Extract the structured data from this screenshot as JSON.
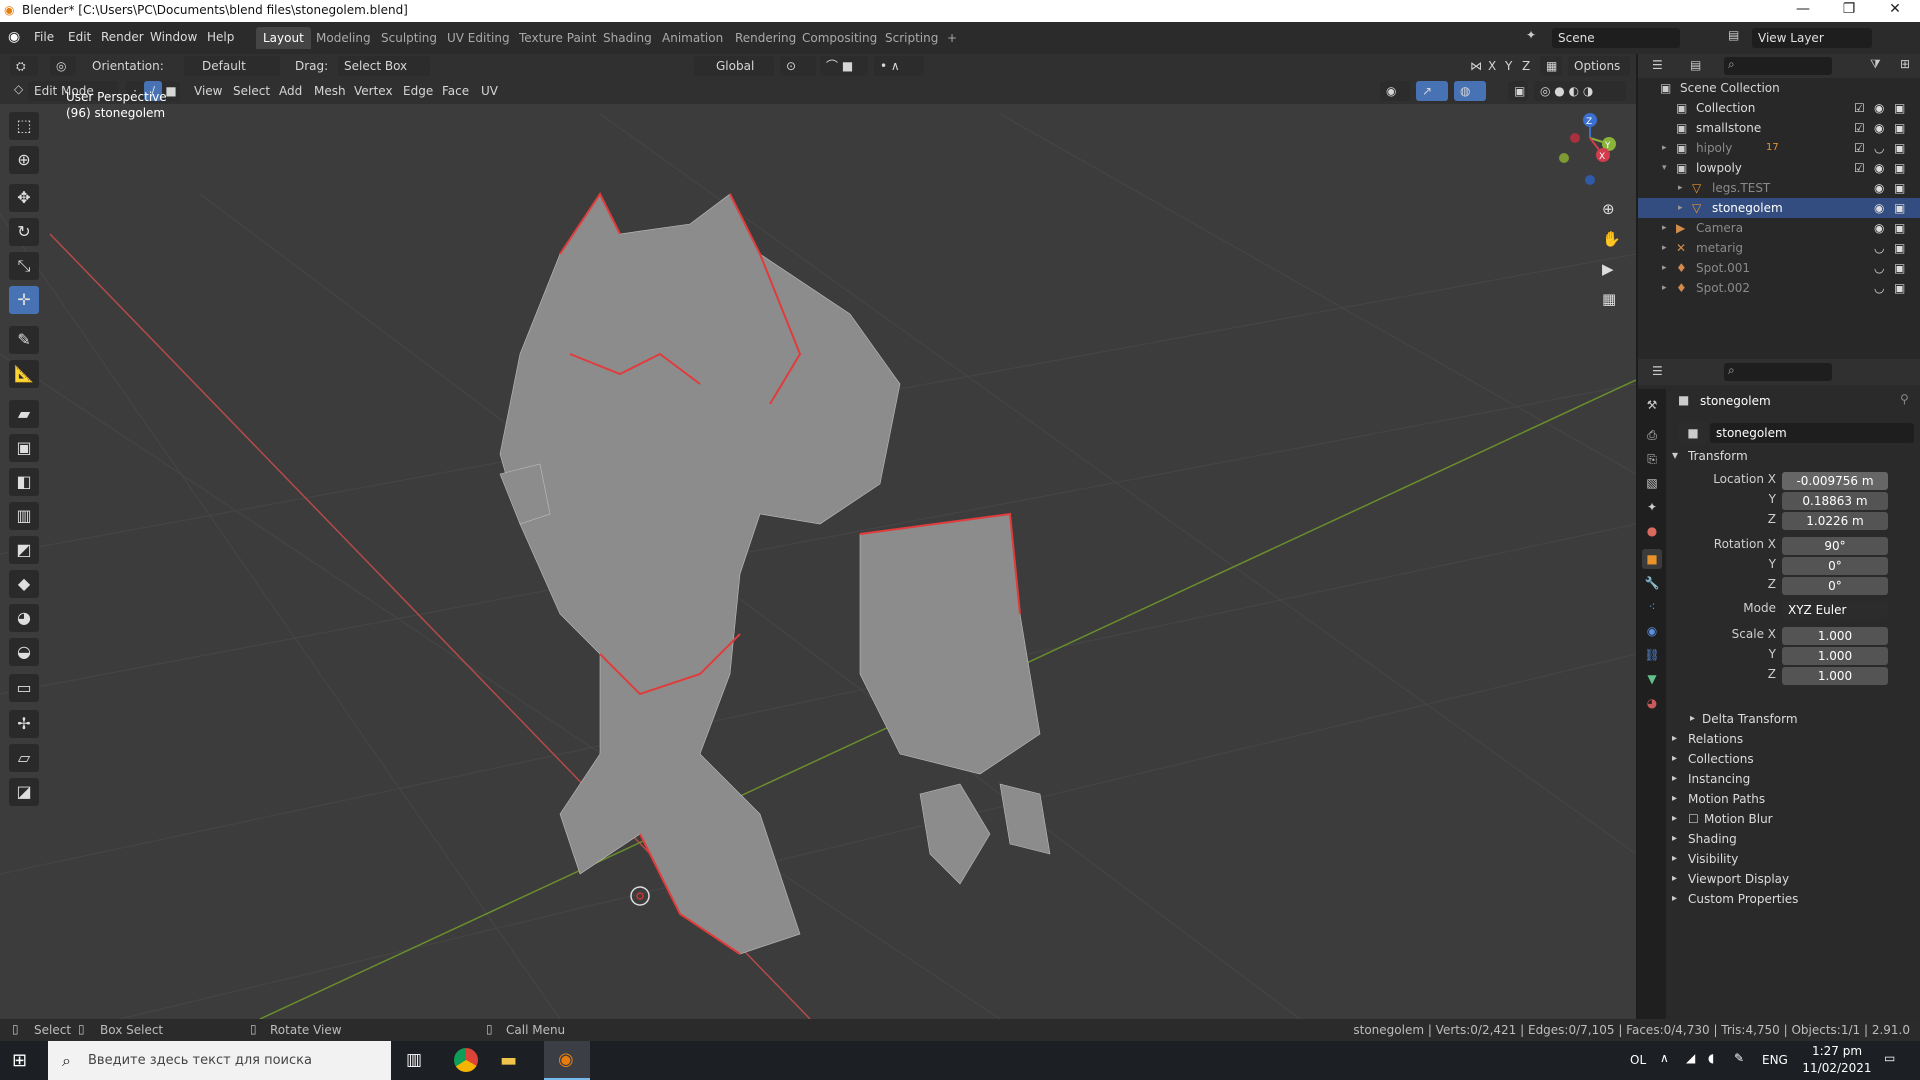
{
  "window": {
    "title": "Blender* [C:\\Users\\PC\\Documents\\blend files\\stonegolem.blend]",
    "min": "—",
    "max": "❐",
    "close": "✕"
  },
  "menubar": {
    "menus": [
      "File",
      "Edit",
      "Render",
      "Window",
      "Help"
    ],
    "workspaces": [
      "Layout",
      "Modeling",
      "Sculpting",
      "UV Editing",
      "Texture Paint",
      "Shading",
      "Animation",
      "Rendering",
      "Compositing",
      "Scripting"
    ],
    "active_workspace": "Layout",
    "add_tab": "+",
    "scene": "Scene",
    "view_layer": "View Layer"
  },
  "viewport_header": {
    "orientation_label": "Orientation:",
    "orientation_value": "Default",
    "drag_label": "Drag:",
    "drag_value": "Select Box",
    "transform_orientation": "Global",
    "axes": [
      "X",
      "Y",
      "Z"
    ],
    "options": "Options",
    "mode": "Edit Mode",
    "menus": [
      "View",
      "Select",
      "Add",
      "Mesh",
      "Vertex",
      "Edge",
      "Face",
      "UV"
    ]
  },
  "viewport": {
    "perspective": "User Perspective",
    "object_label": "(96) stonegolem",
    "gizmo_axes": [
      "Z",
      "Y",
      "X"
    ],
    "accent": "#4772b3"
  },
  "outliner": {
    "root": "Scene Collection",
    "rows": [
      {
        "name": "Collection",
        "dim": false
      },
      {
        "name": "smallstone",
        "dim": false
      },
      {
        "name": "hipoly",
        "dim": true,
        "badge": "17"
      },
      {
        "name": "lowpoly",
        "dim": false
      },
      {
        "name": "legs.TEST",
        "dim": true
      },
      {
        "name": "stonegolem",
        "dim": false,
        "selected": true
      },
      {
        "name": "Camera",
        "dim": true
      },
      {
        "name": "metarig",
        "dim": true
      },
      {
        "name": "Spot.001",
        "dim": true
      },
      {
        "name": "Spot.002",
        "dim": true
      }
    ]
  },
  "properties": {
    "object_name": "stonegolem",
    "datablock": "stonegolem",
    "transform_title": "Transform",
    "location_label": "Location X",
    "location": [
      "-0.009756 m",
      "0.18863 m",
      "1.0226 m"
    ],
    "rotation_label": "Rotation X",
    "rotation": [
      "90°",
      "0°",
      "0°"
    ],
    "mode_label": "Mode",
    "mode_value": "XYZ Euler",
    "scale_label": "Scale X",
    "scale": [
      "1.000",
      "1.000",
      "1.000"
    ],
    "y_label": "Y",
    "z_label": "Z",
    "delta": "Delta Transform",
    "panels": [
      "Relations",
      "Collections",
      "Instancing",
      "Motion Paths",
      "Motion Blur",
      "Shading",
      "Visibility",
      "Viewport Display",
      "Custom Properties"
    ]
  },
  "statusbar": {
    "select": "Select",
    "box_select": "Box Select",
    "rotate_view": "Rotate View",
    "call_menu": "Call Menu",
    "stats": "stonegolem | Verts:0/2,421 | Edges:0/7,105 | Faces:0/4,730 | Tris:4,750 | Objects:1/1 | 2.91.0"
  },
  "taskbar": {
    "search_placeholder": "Введите здесь текст для поиска",
    "tray_ol": "OL",
    "lang": "ENG",
    "time": "1:27 pm",
    "date": "11/02/2021"
  }
}
